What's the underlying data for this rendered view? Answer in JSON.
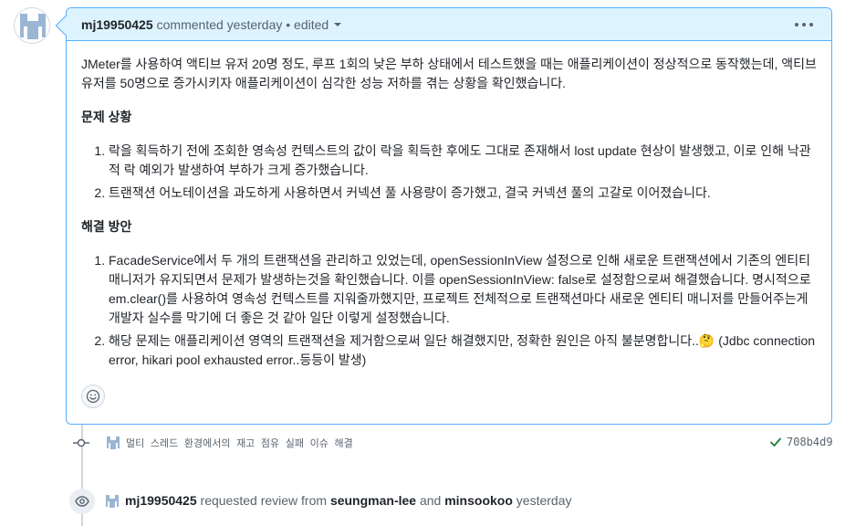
{
  "comment": {
    "author": "mj19950425",
    "meta": "commented yesterday • edited",
    "intro": "JMeter를 사용하여 액티브 유저 20명 정도, 루프 1회의 낮은 부하 상태에서 테스트했을 때는 애플리케이션이 정상적으로 동작했는데, 액티브 유저를 50명으로 증가시키자 애플리케이션이 심각한 성능 저하를 겪는 상황을 확인했습니다.",
    "problem_title": "문제 상황",
    "problems": [
      "락을 획득하기 전에 조회한 영속성 컨텍스트의 값이 락을 획득한 후에도 그대로 존재해서 lost update 현상이 발생했고, 이로 인해 낙관적 락 예외가 발생하여 부하가 크게 증가했습니다.",
      "트랜잭션 어노테이션을 과도하게 사용하면서 커넥션 풀 사용량이 증가했고, 결국 커넥션 풀의 고갈로 이어졌습니다."
    ],
    "solution_title": "해결 방안",
    "solutions": [
      "FacadeService에서 두 개의 트랜잭션을 관리하고 있었는데, openSessionInView 설정으로 인해 새로운 트랜잭션에서 기존의 엔티티 매니저가 유지되면서 문제가 발생하는것을 확인했습니다. 이를 openSessionInView: false로 설정함으로써 해결했습니다. 명시적으로 em.clear()를 사용하여 영속성 컨텍스트를 지워줄까했지만, 프로젝트 전체적으로 트랜잭션마다 새로운 엔티티 매니저를 만들어주는게 개발자 실수를 막기에 더 좋은 것 같아 일단 이렇게 설정했습니다.",
      "해당 문제는 애플리케이션 영역의 트랜잭션을 제거함으로써 일단 해결했지만, 정확한 원인은 아직 불분명합니다..🤔 (Jdbc connection error, hikari pool exhausted error..등등이 발생)"
    ]
  },
  "commit": {
    "message": "멀티 스레드 환경에서의 재고 점유 실패 이슈 해결",
    "sha": "708b4d9"
  },
  "review": {
    "author": "mj19950425",
    "action": "requested review from",
    "reviewer1": "seungman-lee",
    "conj": "and",
    "reviewer2": "minsookoo",
    "time": "yesterday"
  },
  "colors": {
    "header_bg": "#ddf4ff",
    "border": "#54aeff",
    "success": "#1a7f37",
    "muted": "#59636e"
  },
  "icons": [
    "avatar-identicon",
    "kebab-icon",
    "smiley-icon",
    "commit-icon",
    "check-icon",
    "eye-icon",
    "caret-down-icon"
  ]
}
